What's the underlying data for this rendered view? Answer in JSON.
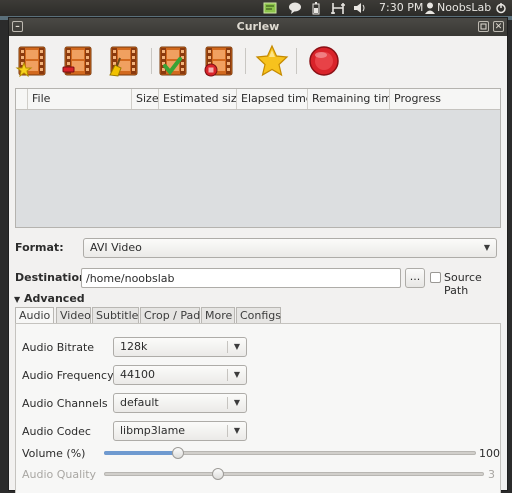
{
  "topbar": {
    "time": "7:30 PM",
    "user": "NoobsLab",
    "icons": [
      "notes-icon",
      "chat-icon",
      "battery-icon",
      "network-icon",
      "volume-icon",
      "mail-icon",
      "user-icon",
      "power-icon"
    ]
  },
  "window": {
    "title": "Curlew",
    "controls": {
      "minimize": "–",
      "close": "✕"
    }
  },
  "toolbar": {
    "buttons": [
      {
        "name": "add-file-button",
        "icon": "film-star-icon"
      },
      {
        "name": "remove-file-button",
        "icon": "film-minus-icon"
      },
      {
        "name": "clear-list-button",
        "icon": "film-broom-icon"
      },
      {
        "name": "convert-button",
        "icon": "film-check-icon"
      },
      {
        "name": "stop-button",
        "icon": "film-stop-icon"
      },
      {
        "name": "about-button",
        "icon": "star-icon"
      },
      {
        "name": "quit-button",
        "icon": "quit-icon"
      }
    ]
  },
  "filelist": {
    "columns": [
      "File",
      "Size",
      "Estimated size",
      "Elapsed time",
      "Remaining time",
      "Progress"
    ]
  },
  "format": {
    "label": "Format:",
    "value": "AVI Video"
  },
  "destination": {
    "label": "Destination:",
    "value": "/home/noobslab",
    "browse": "...",
    "source_path": "Source Path"
  },
  "advanced": {
    "label": "Advanced"
  },
  "tabs": [
    "Audio",
    "Video",
    "Subtitle",
    "Crop / Pad",
    "More",
    "Configs"
  ],
  "audio": {
    "bitrate": {
      "label": "Audio Bitrate",
      "value": "128k"
    },
    "frequency": {
      "label": "Audio Frequency",
      "value": "44100"
    },
    "channels": {
      "label": "Audio Channels",
      "value": "default"
    },
    "codec": {
      "label": "Audio Codec",
      "value": "libmp3lame"
    },
    "volume": {
      "label": "Volume (%)",
      "value": "100",
      "fraction": 0.2
    },
    "quality": {
      "label": "Audio Quality",
      "value": "3",
      "fraction": 0.3
    }
  },
  "colors": {
    "accent": "#6f9ad0",
    "titlebar": "#3e3d39"
  }
}
